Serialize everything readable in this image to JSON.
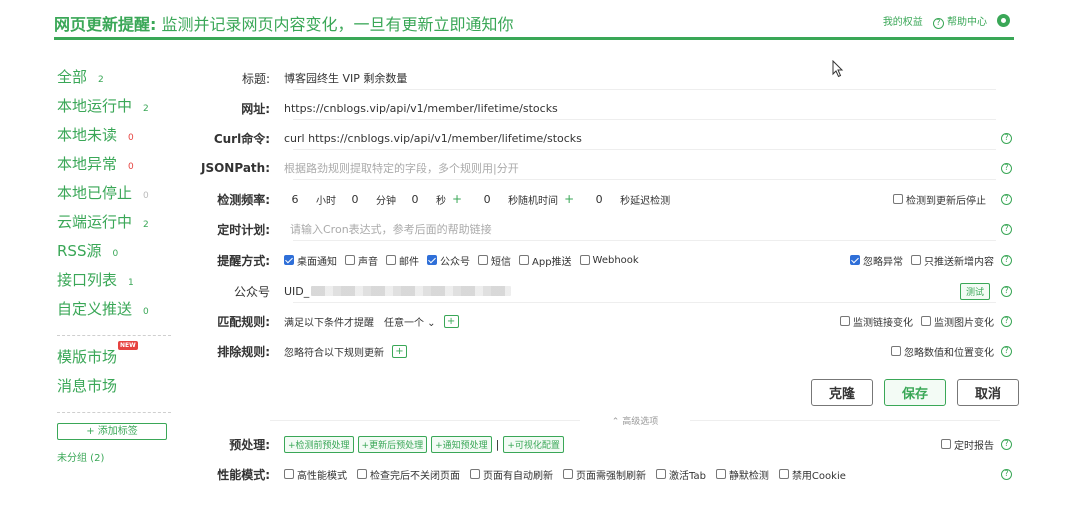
{
  "header": {
    "title_bold": "网页更新提醒:",
    "title_rest": " 监测并记录网页内容变化，一旦有更新立即通知你",
    "rights": "我的权益",
    "help": "帮助中心"
  },
  "sidebar": {
    "items": [
      {
        "label": "全部",
        "count": "2"
      },
      {
        "label": "本地运行中",
        "count": "2"
      },
      {
        "label": "本地未读",
        "count": "0"
      },
      {
        "label": "本地异常",
        "count": "0"
      },
      {
        "label": "本地已停止",
        "count": "0"
      },
      {
        "label": "云端运行中",
        "count": "2"
      },
      {
        "label": "RSS源",
        "count": "0"
      },
      {
        "label": "接口列表",
        "count": "1"
      },
      {
        "label": "自定义推送",
        "count": "0"
      }
    ],
    "market": "模版市场",
    "market_badge": "NEW",
    "msg_market": "消息市场",
    "add_tag": "+ 添加标签",
    "ungrouped": "未分组 (2)"
  },
  "form": {
    "title_label": "标题:",
    "title_value": "博客园终生 VIP 剩余数量",
    "url_label": "网址:",
    "url_value": "https://cnblogs.vip/api/v1/member/lifetime/stocks",
    "curl_label": "Curl命令:",
    "curl_value": "curl https://cnblogs.vip/api/v1/member/lifetime/stocks",
    "jsonpath_label": "JSONPath:",
    "jsonpath_placeholder": "根据路劲规则提取特定的字段，多个规则用|分开",
    "freq_label": "检测频率:",
    "freq": {
      "hours": "6",
      "hours_unit": "小时",
      "minutes": "0",
      "minutes_unit": "分钟",
      "seconds": "0",
      "seconds_unit": "秒",
      "random": "0",
      "random_unit": "秒随机时间",
      "delay": "0",
      "delay_unit": "秒延迟检测",
      "stop_label": "检测到更新后停止"
    },
    "cron_label": "定时计划:",
    "cron_placeholder": "请输入Cron表达式，参考后面的帮助链接",
    "notify_label": "提醒方式:",
    "notify_options": [
      {
        "label": "桌面通知",
        "checked": true
      },
      {
        "label": "声音",
        "checked": false
      },
      {
        "label": "邮件",
        "checked": false
      },
      {
        "label": "公众号",
        "checked": true
      },
      {
        "label": "短信",
        "checked": false
      },
      {
        "label": "App推送",
        "checked": false
      },
      {
        "label": "Webhook",
        "checked": false
      }
    ],
    "ignore_error": "忽略异常",
    "only_new": "只推送新增内容",
    "gzh_label": "公众号",
    "gzh_value": "UID_",
    "test": "测试",
    "match_label": "匹配规则:",
    "match_text": "满足以下条件才提醒",
    "match_select": "任意一个",
    "watch_link": "监测链接变化",
    "watch_image": "监测图片变化",
    "exclude_label": "排除规则:",
    "exclude_text": "忽略符合以下规则更新",
    "ignore_num": "忽略数值和位置变化"
  },
  "actions": {
    "clone": "克隆",
    "save": "保存",
    "cancel": "取消"
  },
  "advanced": {
    "title": "高级选项",
    "preprocess_label": "预处理:",
    "pre_buttons": [
      "+检测前预处理",
      "+更新后预处理",
      "+通知预处理"
    ],
    "visual": "+可视化配置",
    "timer_report": "定时报告",
    "perf_label": "性能模式:",
    "perf_options": [
      "高性能模式",
      "检查完后不关闭页面",
      "页面有自动刷新",
      "页面需强制刷新",
      "激活Tab",
      "静默检测",
      "禁用Cookie"
    ]
  }
}
